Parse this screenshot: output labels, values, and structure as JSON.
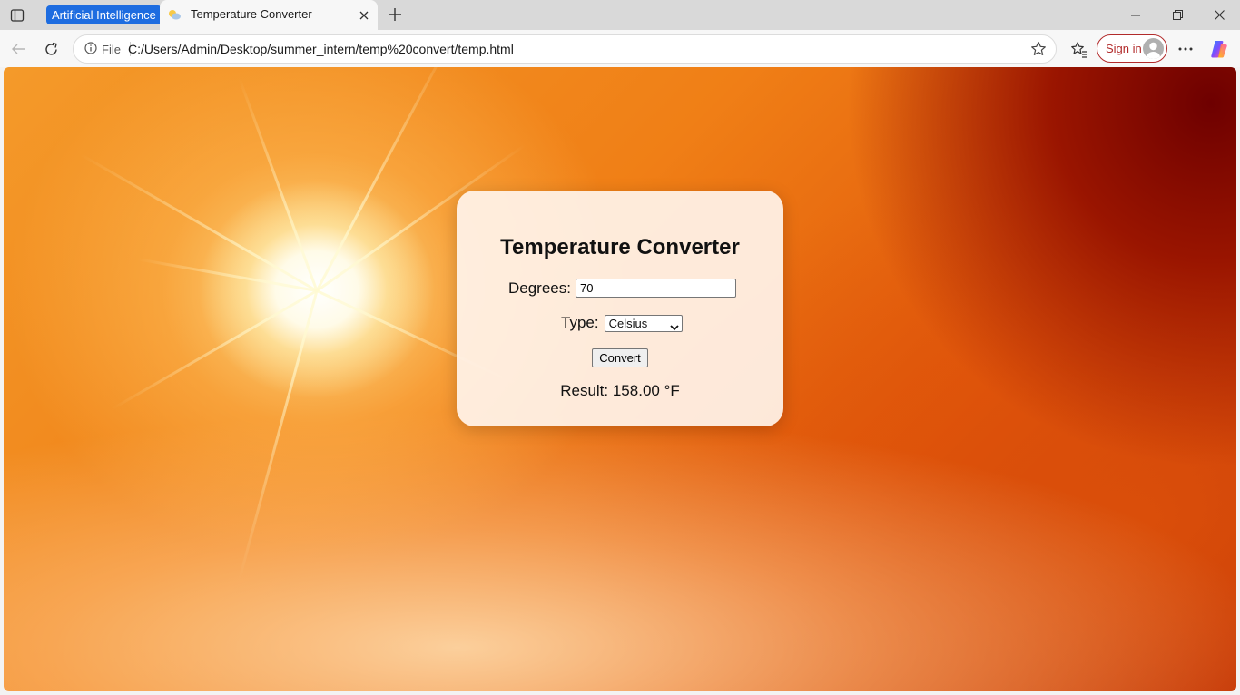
{
  "browser": {
    "tab_group_label": "Artificial Intelligence",
    "active_tab_title": "Temperature Converter",
    "site_info_label": "File",
    "url": "C:/Users/Admin/Desktop/summer_intern/temp%20convert/temp.html",
    "signin_label": "Sign in",
    "icons": [
      "tab-actions-icon",
      "favicon-icon",
      "close-icon",
      "new-tab-icon",
      "minimize-icon",
      "maximize-icon",
      "window-close-icon",
      "back-icon",
      "refresh-icon",
      "info-icon",
      "favorite-star-icon",
      "favorites-icon",
      "avatar-icon",
      "more-icon",
      "copilot-icon"
    ],
    "accent_color": "#1d6ce0"
  },
  "converter": {
    "title": "Temperature Converter",
    "degrees_label": "Degrees:",
    "degrees_value": "70",
    "type_label": "Type:",
    "type_selected": "Celsius",
    "convert_label": "Convert",
    "result_text": "Result: 158.00 °F"
  }
}
